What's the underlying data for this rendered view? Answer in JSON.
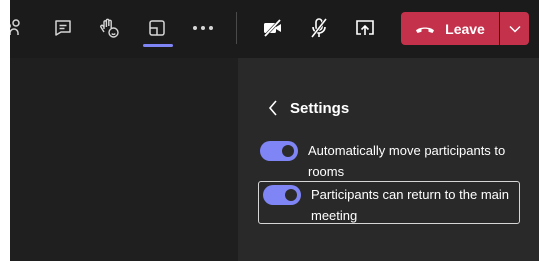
{
  "toolbar": {
    "icons": [
      "people-icon",
      "chat-icon",
      "raise-hand-icon",
      "breakout-rooms-icon",
      "more-options-icon",
      "camera-off-icon",
      "mic-off-icon",
      "share-screen-icon"
    ],
    "accent_color": "#7f85f5"
  },
  "leave": {
    "label": "Leave",
    "color": "#c4314b"
  },
  "panel": {
    "title": "Settings",
    "settings": [
      {
        "label": "Automatically move participants to rooms",
        "enabled": true
      },
      {
        "label": "Participants can return to the main meeting",
        "enabled": true
      }
    ]
  }
}
